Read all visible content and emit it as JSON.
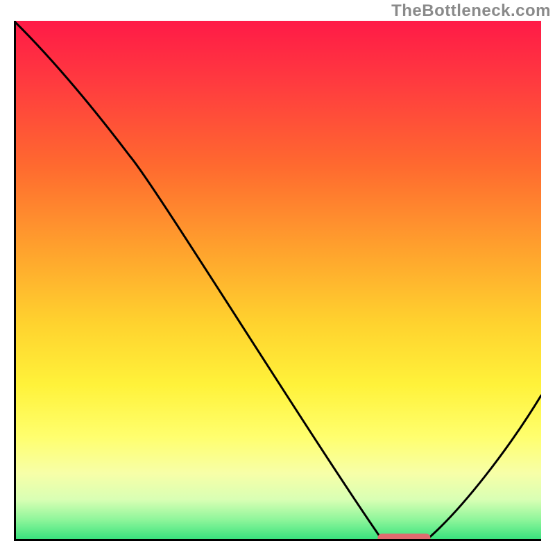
{
  "watermark": {
    "text": "TheBottleneck.com"
  },
  "chart_data": {
    "type": "line",
    "title": "",
    "xlabel": "",
    "ylabel": "",
    "xlim": [
      0,
      100
    ],
    "ylim": [
      0,
      100
    ],
    "grid": false,
    "legend": false,
    "x": [
      0,
      22,
      70,
      78,
      100
    ],
    "values": [
      100,
      74,
      0,
      0,
      28
    ],
    "series_note": "Single black curve: steep descent, bend near x≈22, minimum plateau near x≈70–78, rises toward right edge.",
    "marker": {
      "x_range": [
        69,
        79
      ],
      "y": 0.5,
      "color": "#e06a6f",
      "shape": "rounded-bar"
    },
    "background": {
      "type": "vertical-gradient",
      "stops": [
        {
          "pos": 0.0,
          "color": "#ff1a47"
        },
        {
          "pos": 0.28,
          "color": "#ff6a2f"
        },
        {
          "pos": 0.58,
          "color": "#ffd22e"
        },
        {
          "pos": 0.8,
          "color": "#ffff6e"
        },
        {
          "pos": 0.96,
          "color": "#8cf59a"
        },
        {
          "pos": 1.0,
          "color": "#30e07a"
        }
      ]
    }
  }
}
